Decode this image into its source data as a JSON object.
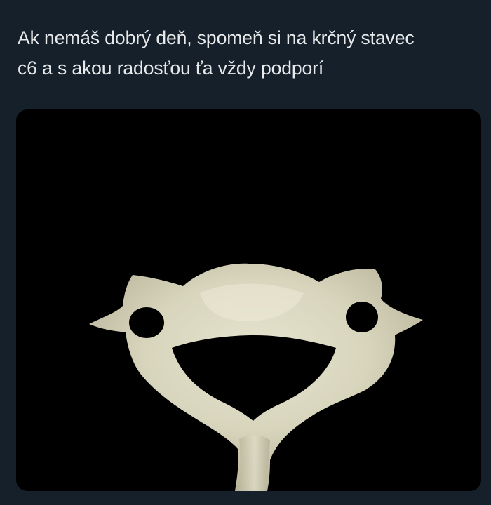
{
  "tweet": {
    "text_lines": [
      "Ak nemáš dobrý deň, spomeň si na krčný stavec",
      "c6 a s akou radosťou ťa vždy podporí"
    ]
  },
  "media": {
    "icon": "vertebra-c6-image",
    "background_color": "#000000",
    "bone_color": "#d9d7c0"
  }
}
